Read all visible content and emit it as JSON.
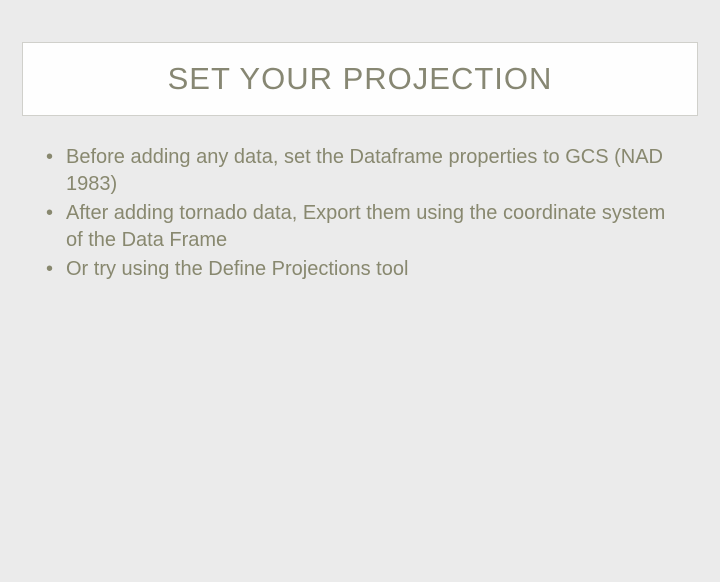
{
  "slide": {
    "title": "SET YOUR PROJECTION",
    "bullets": [
      "Before adding any data, set the Dataframe properties to GCS (NAD 1983)",
      "After adding tornado data, Export them using the coordinate system of the Data Frame",
      "Or try using the Define Projections tool"
    ]
  }
}
